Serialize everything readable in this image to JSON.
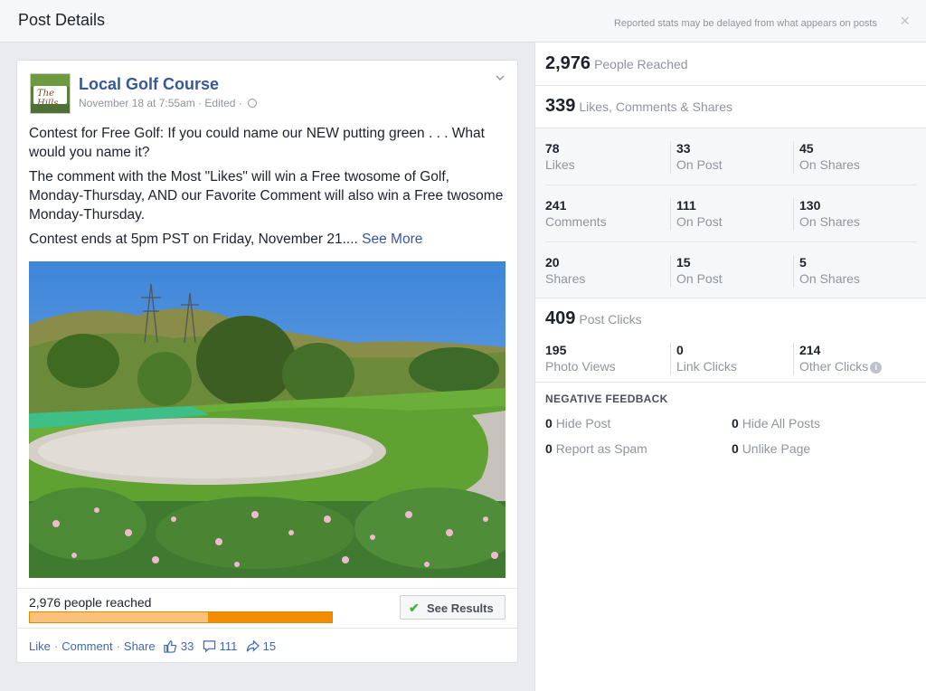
{
  "header": {
    "title": "Post Details",
    "note": "Reported stats may be delayed from what appears on posts",
    "close_icon": "×"
  },
  "post": {
    "page_name": "Local Golf Course",
    "avatar_text": "The Hills",
    "meta": "November 18 at 7:55am · Edited ·",
    "paragraphs": [
      "Contest for Free Golf: If you could name our NEW putting green . . . What would you name it?",
      "The comment with the Most \"Likes\" will win a Free twosome of Golf, Monday-Thursday, AND our Favorite Comment will also win a Free twosome Monday-Thursday.",
      "Contest ends at 5pm PST on Friday, November 21...."
    ],
    "see_more": "See More",
    "reach_text": "2,976 people reached",
    "reach_bar_paid_fraction": 0.41,
    "see_results": "See Results",
    "actions": {
      "like": "Like",
      "comment": "Comment",
      "share": "Share",
      "like_count": "33",
      "comment_count": "111",
      "share_count": "15"
    }
  },
  "stats": {
    "people_reached": {
      "value": "2,976",
      "label": "People Reached"
    },
    "engagement": {
      "value": "339",
      "label": "Likes, Comments & Shares"
    },
    "likes": [
      {
        "value": "78",
        "label": "Likes"
      },
      {
        "value": "33",
        "label": "On Post"
      },
      {
        "value": "45",
        "label": "On Shares"
      }
    ],
    "comments": [
      {
        "value": "241",
        "label": "Comments"
      },
      {
        "value": "111",
        "label": "On Post"
      },
      {
        "value": "130",
        "label": "On Shares"
      }
    ],
    "shares": [
      {
        "value": "20",
        "label": "Shares"
      },
      {
        "value": "15",
        "label": "On Post"
      },
      {
        "value": "5",
        "label": "On Shares"
      }
    ],
    "post_clicks": {
      "value": "409",
      "label": "Post Clicks"
    },
    "clicks": [
      {
        "value": "195",
        "label": "Photo Views"
      },
      {
        "value": "0",
        "label": "Link Clicks"
      },
      {
        "value": "214",
        "label": "Other Clicks"
      }
    ],
    "negative_title": "NEGATIVE FEEDBACK",
    "negative": [
      {
        "value": "0",
        "label": "Hide Post"
      },
      {
        "value": "0",
        "label": "Hide All Posts"
      },
      {
        "value": "0",
        "label": "Report as Spam"
      },
      {
        "value": "0",
        "label": "Unlike Page"
      }
    ]
  }
}
